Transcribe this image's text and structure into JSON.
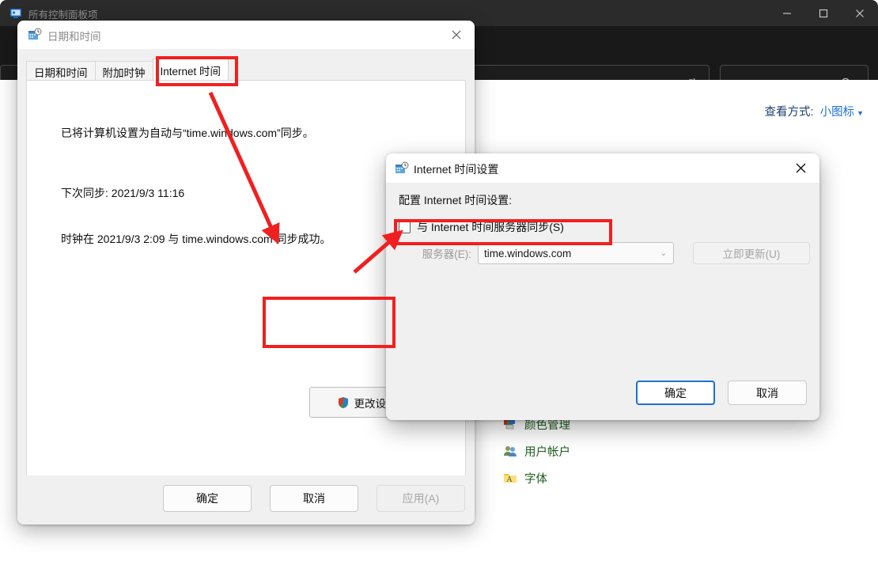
{
  "control_panel": {
    "title": "所有控制面板项",
    "title_icon": "control-panel-icon",
    "window_buttons": {
      "minimize": "—",
      "maximize": "▢",
      "close": "✕"
    },
    "address_bar": {
      "chevron_icon": "chevron-down-icon",
      "refresh_icon": "refresh-icon"
    },
    "search": {
      "placeholder": "",
      "value": "",
      "icon": "search-icon"
    },
    "view_by": {
      "label": "查看方式:",
      "value": "小图标",
      "caret": "▼"
    },
    "items": [
      {
        "label": "颜色管理",
        "icon": "color-management-icon"
      },
      {
        "label": "用户帐户",
        "icon": "user-accounts-icon"
      },
      {
        "label": "字体",
        "icon": "fonts-icon"
      }
    ]
  },
  "date_time_dialog": {
    "title": "日期和时间",
    "title_icon": "date-time-icon",
    "close_icon": "✕",
    "tabs": [
      {
        "label": "日期和时间",
        "active": false
      },
      {
        "label": "附加时钟",
        "active": false
      },
      {
        "label": "Internet 时间",
        "active": true
      }
    ],
    "panel": {
      "line1": "已将计算机设置为自动与“time.windows.com”同步。",
      "line2": "下次同步: 2021/9/3 11:16",
      "line3": "时钟在 2021/9/3 2:09 与 time.windows.com 同步成功。"
    },
    "change_settings_button": {
      "label": "更改设置",
      "shield_icon": "uac-shield-icon"
    },
    "footer": {
      "ok": "确定",
      "cancel": "取消",
      "apply": "应用(A)",
      "apply_disabled": true
    }
  },
  "internet_time_dialog": {
    "title": "Internet 时间设置",
    "title_icon": "date-time-icon",
    "close_icon": "✕",
    "heading": "配置 Internet 时间设置:",
    "sync_checkbox": {
      "label": "与 Internet 时间服务器同步(S)",
      "checked": false
    },
    "server_field": {
      "label": "服务器(E):",
      "value": "time.windows.com",
      "chevron": "⌄",
      "disabled": true
    },
    "update_button": {
      "label": "立即更新(U)",
      "disabled": true
    },
    "footer": {
      "ok": "确定",
      "cancel": "取消"
    }
  },
  "annotations": {
    "accent_color": "#f02020",
    "highlight_tab": "Internet 时间",
    "highlight_change_settings": "更改设置",
    "highlight_sync_checkbox": "与 Internet 时间服务器同步(S)"
  }
}
